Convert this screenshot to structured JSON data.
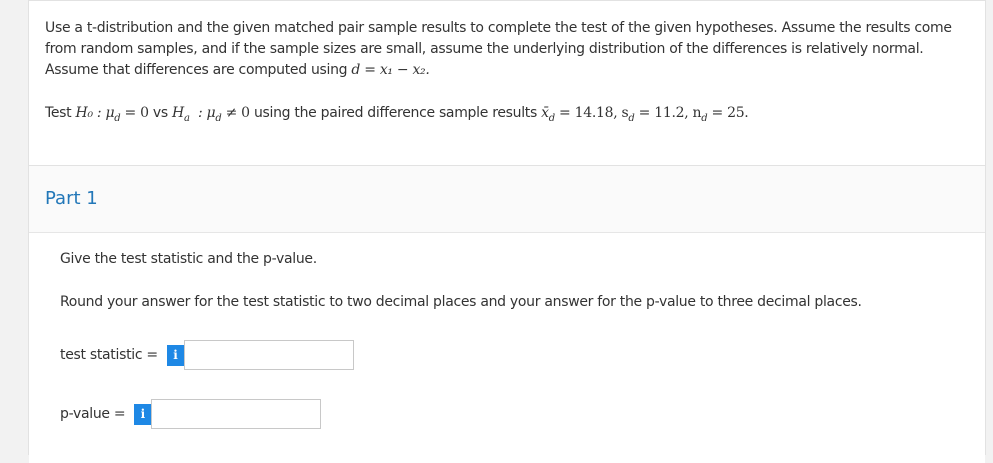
{
  "question": {
    "line1": "Use a t-distribution and the given matched pair sample results to complete the test of the given hypotheses. Assume the results come",
    "line2": "from random samples, and if the sample sizes are small, assume the underlying distribution of the differences is relatively normal.",
    "line3_prefix": "Assume that differences are computed using ",
    "line3_math": "d = x₁ − x₂.",
    "test_prefix": "Test ",
    "h0": "H₀ : μ",
    "h0_rest": " = 0",
    "vs": " vs ",
    "ha": "H",
    "ha_rest": " ≠ 0",
    "using": " using the paired difference sample results ",
    "stats": "x̄",
    "stats_rest": " = 14.18, s",
    "stats_rest2": " = 11.2, n",
    "stats_rest3": " = 25."
  },
  "part": {
    "title": "Part 1",
    "instruction": "Give the test statistic and the p-value.",
    "rounding": "Round your answer for the test statistic to two decimal places and your answer for the p-value to three decimal places.",
    "test_statistic_label": "test statistic =",
    "p_value_label": "p-value =",
    "info_glyph": "i",
    "test_statistic_value": "",
    "p_value_value": ""
  },
  "colors": {
    "accent": "#2277b8",
    "info_button": "#1e88e5",
    "background": "#f2f2f2"
  }
}
